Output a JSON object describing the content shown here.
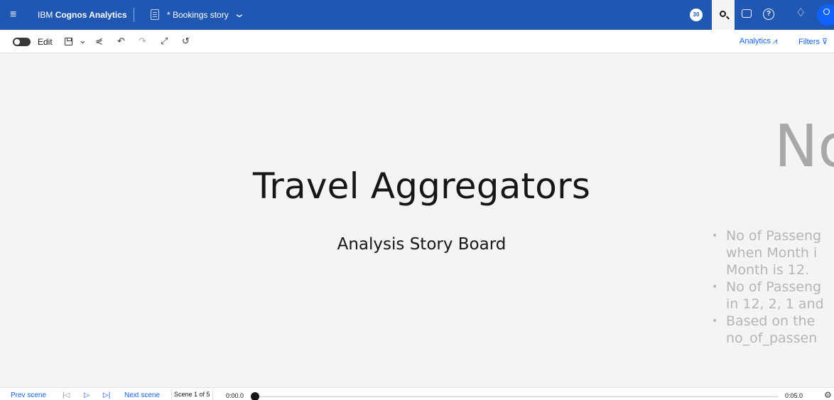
{
  "header": {
    "menu_glyph": "≡",
    "brand_prefix": "IBM",
    "brand_name": "Cognos Analytics",
    "story_title": "* Bookings story",
    "chevron": "⌄",
    "timer_badge": "30",
    "help_glyph": "?",
    "bell_glyph": "♢"
  },
  "toolbar": {
    "edit_label": "Edit",
    "dropdown_glyph": "⌄",
    "share_glyph": "⋞",
    "undo_glyph": "↶",
    "redo_glyph": "↷",
    "expand_glyph": "⤢",
    "reset_glyph": "↺",
    "analytics_label": "Analytics",
    "analytics_glyph": "⩘",
    "filters_label": "Filters",
    "filters_glyph": "⊽"
  },
  "scene": {
    "title": "Travel Aggregators",
    "subtitle": "Analysis Story Board"
  },
  "next_scene_preview": {
    "title_fragment": "No",
    "bullets": [
      "No of Passeng\nwhen Month i\nMonth is 12.",
      "No of Passeng\nin 12, 2, 1 and",
      "Based on the\nno_of_passen"
    ]
  },
  "playback": {
    "prev_scene_label": "Prev scene",
    "skip_back_glyph": "|◁",
    "play_glyph": "▷",
    "skip_forward_glyph": "▷|",
    "next_scene_label": "Next scene",
    "scene_counter": "Scene 1 of 5",
    "current_time": "0:00.0",
    "end_time": "0:05.0",
    "settings_glyph": "⚙"
  },
  "colors": {
    "header_bg": "#1f57b3",
    "accent": "#0f62fe",
    "canvas_bg": "#f4f4f4"
  },
  "icons": [
    "menu-icon",
    "story-icon",
    "chevron-down-icon",
    "timer-icon",
    "search-icon",
    "chat-icon",
    "help-icon",
    "bell-icon",
    "user-icon",
    "save-icon",
    "share-icon",
    "undo-icon",
    "redo-icon",
    "expand-icon",
    "reset-icon",
    "analytics-icon",
    "filter-icon",
    "notes-icon",
    "settings-icon"
  ]
}
